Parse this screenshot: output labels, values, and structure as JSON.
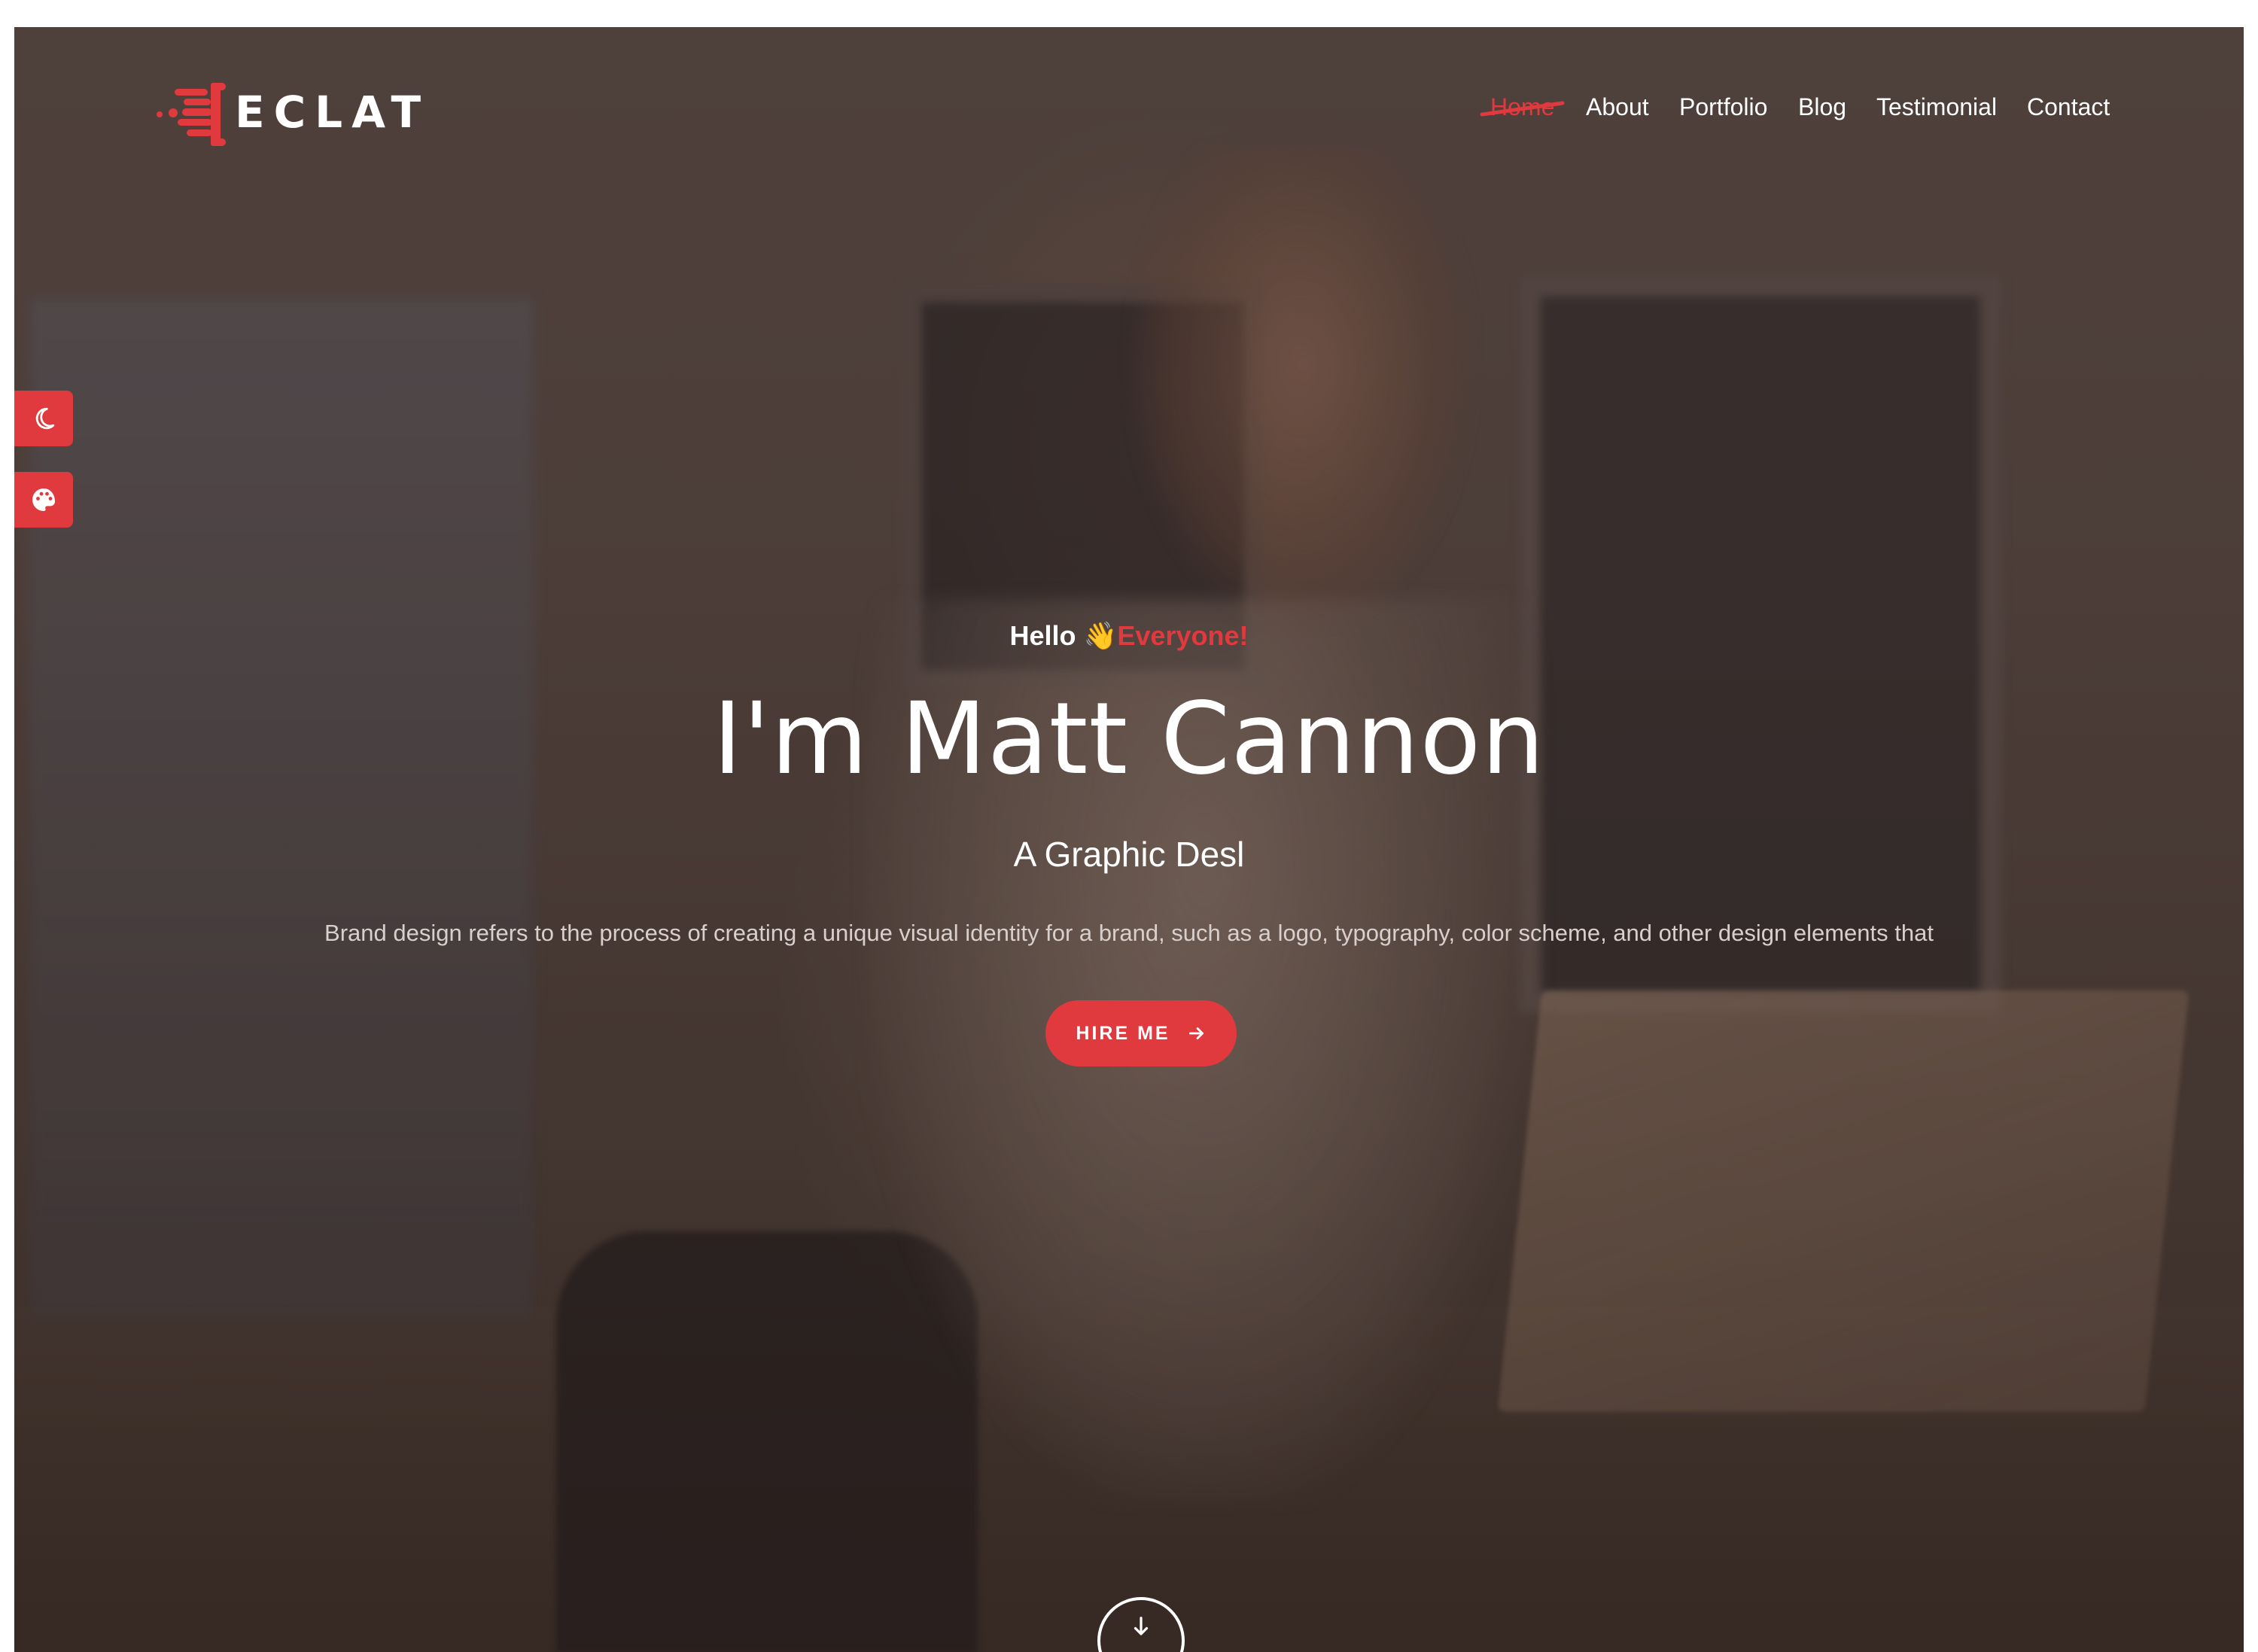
{
  "brand": {
    "name": "ECLAT",
    "accent_color": "#e0393e"
  },
  "nav": {
    "items": [
      {
        "label": "Home",
        "active": true
      },
      {
        "label": "About",
        "active": false
      },
      {
        "label": "Portfolio",
        "active": false
      },
      {
        "label": "Blog",
        "active": false
      },
      {
        "label": "Testimonial",
        "active": false
      },
      {
        "label": "Contact",
        "active": false
      }
    ]
  },
  "side_tools": {
    "dark_mode_icon": "moon-icon",
    "palette_icon": "palette-icon"
  },
  "hero": {
    "greeting": "Hello",
    "greeting_emoji": "👋",
    "greeting_accent": "Everyone!",
    "title": "I'm Matt Cannon",
    "subtitle": "A Graphic Desl",
    "description": "Brand design refers to the process of creating a unique visual identity for a brand, such as a logo, typography, color scheme, and other design elements that",
    "cta_label": "HIRE ME",
    "cta_icon": "arrow-right-icon",
    "scroll_icon": "arrow-down-icon"
  }
}
